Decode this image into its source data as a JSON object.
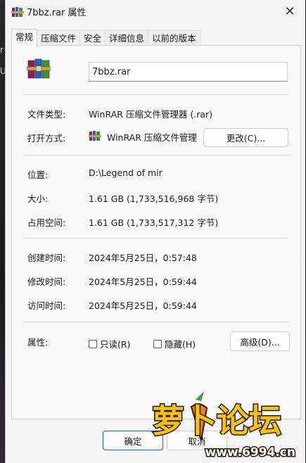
{
  "background": {
    "frag1": "r",
    "frag2": "U"
  },
  "window": {
    "title": "7bbz.rar 属性",
    "close_glyph": "✕"
  },
  "tabs": [
    {
      "label": "常规",
      "active": true
    },
    {
      "label": "压缩文件",
      "active": false
    },
    {
      "label": "安全",
      "active": false
    },
    {
      "label": "详细信息",
      "active": false
    },
    {
      "label": "以前的版本",
      "active": false
    }
  ],
  "general": {
    "file_name": "7bbz.rar",
    "type_label": "文件类型:",
    "type_value": "WinRAR 压缩文件管理器 (.rar)",
    "opens_label": "打开方式:",
    "opens_value": "WinRAR 压缩文件管理器",
    "change_button": "更改(C)...",
    "location_label": "位置:",
    "location_value": "D:\\Legend of mir",
    "size_label": "大小:",
    "size_value": "1.61 GB (1,733,516,968 字节)",
    "size_on_disk_label": "占用空间:",
    "size_on_disk_value": "1.61 GB (1,733,517,312 字节)",
    "created_label": "创建时间:",
    "created_value": "2024年5月25日，0:57:48",
    "modified_label": "修改时间:",
    "modified_value": "2024年5月25日，0:59:44",
    "accessed_label": "访问时间:",
    "accessed_value": "2024年5月25日，0:59:44",
    "attributes_label": "属性:",
    "readonly_label": "只读(R)",
    "hidden_label": "隐藏(H)",
    "advanced_button": "高级(D)..."
  },
  "footer": {
    "ok_button": "确定",
    "cancel_button": "取消"
  },
  "watermark": {
    "brand": "萝卜论坛",
    "site": "www.6994.cn"
  },
  "icons": {
    "file": "winrar-books-icon",
    "close": "close-icon"
  }
}
